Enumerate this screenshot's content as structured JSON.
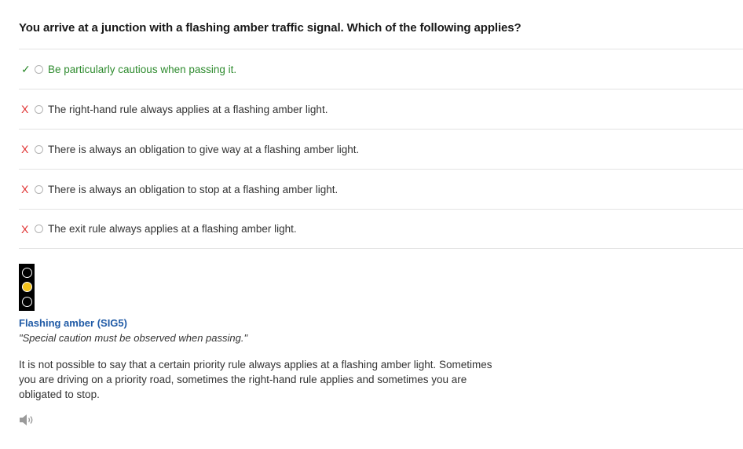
{
  "question": "You arrive at a junction with a flashing amber traffic signal. Which of the following applies?",
  "options": [
    {
      "mark": "✓",
      "text": "Be particularly cautious when passing it."
    },
    {
      "mark": "X",
      "text": "The right-hand rule always applies at a flashing amber light."
    },
    {
      "mark": "X",
      "text": "There is always an obligation to give way at a flashing amber light."
    },
    {
      "mark": "X",
      "text": "There is always an obligation to stop at a flashing amber light."
    },
    {
      "mark": "X",
      "text": "The exit rule always applies at a flashing amber light."
    }
  ],
  "sign": {
    "title": "Flashing amber (SIG5)",
    "quote": "\"Special caution must be observed when passing.\""
  },
  "explanation": "It is not possible to say that a certain priority rule always applies at a flashing amber light. Sometimes you are driving on a priority road, sometimes the right-hand rule applies and sometimes you are obligated to stop.",
  "colors": {
    "correct": "#2e8b2e",
    "wrong": "#e03030",
    "title": "#1f5aa6",
    "amber": "#f2c21b"
  },
  "icons": {
    "correct": "check-icon",
    "wrong": "cross-icon",
    "audio": "speaker-icon"
  }
}
